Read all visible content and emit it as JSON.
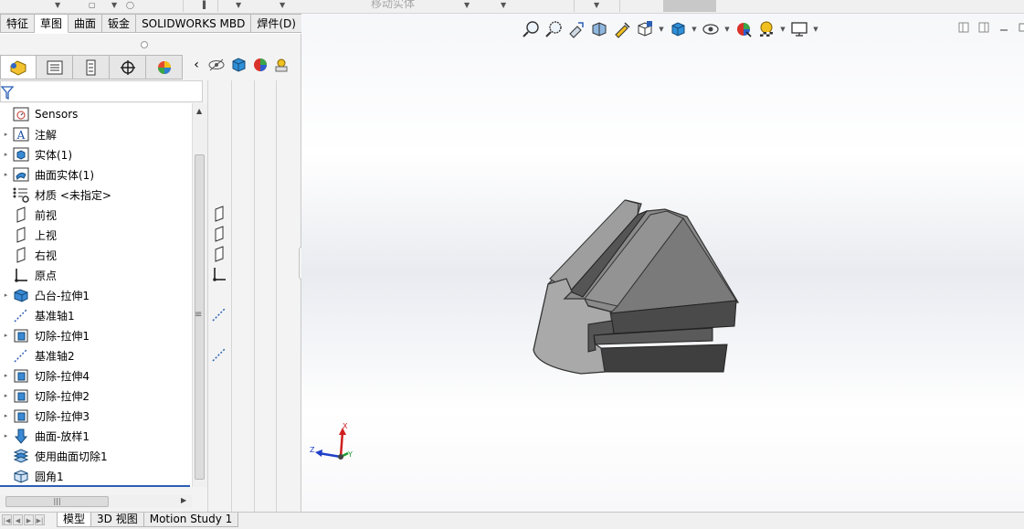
{
  "toolbar_top": {
    "faded_label": "移动实体"
  },
  "command_tabs": [
    {
      "label": "特征",
      "active": false
    },
    {
      "label": "草图",
      "active": true
    },
    {
      "label": "曲面",
      "active": false
    },
    {
      "label": "钣金",
      "active": false
    },
    {
      "label": "SOLIDWORKS MBD",
      "active": false
    },
    {
      "label": "焊件(D)",
      "active": false
    }
  ],
  "feature_tree": [
    {
      "label": "Sensors",
      "icon": "sensor-icon",
      "expandable": false
    },
    {
      "label": "注解",
      "icon": "annotation-icon",
      "expandable": true
    },
    {
      "label": "实体(1)",
      "icon": "solid-bodies-icon",
      "expandable": true
    },
    {
      "label": "曲面实体(1)",
      "icon": "surface-bodies-icon",
      "expandable": true
    },
    {
      "label": "材质 <未指定>",
      "icon": "material-icon",
      "expandable": false
    },
    {
      "label": "前视",
      "icon": "plane-icon",
      "expandable": false
    },
    {
      "label": "上视",
      "icon": "plane-icon",
      "expandable": false
    },
    {
      "label": "右视",
      "icon": "plane-icon",
      "expandable": false
    },
    {
      "label": "原点",
      "icon": "origin-icon",
      "expandable": false
    },
    {
      "label": "凸台-拉伸1",
      "icon": "extrude-boss-icon",
      "expandable": true
    },
    {
      "label": "基准轴1",
      "icon": "axis-icon",
      "expandable": false
    },
    {
      "label": "切除-拉伸1",
      "icon": "extrude-cut-icon",
      "expandable": true
    },
    {
      "label": "基准轴2",
      "icon": "axis-icon",
      "expandable": false
    },
    {
      "label": "切除-拉伸4",
      "icon": "extrude-cut-icon",
      "expandable": true
    },
    {
      "label": "切除-拉伸2",
      "icon": "extrude-cut-icon",
      "expandable": true
    },
    {
      "label": "切除-拉伸3",
      "icon": "extrude-cut-icon",
      "expandable": true
    },
    {
      "label": "曲面-放样1",
      "icon": "surface-loft-icon",
      "expandable": true
    },
    {
      "label": "使用曲面切除1",
      "icon": "surface-cut-icon",
      "expandable": false
    },
    {
      "label": "圆角1",
      "icon": "fillet-icon",
      "expandable": false
    }
  ],
  "triad": {
    "x": "X",
    "y": "Y",
    "z": "Z"
  },
  "bottom_tabs": [
    {
      "label": "模型",
      "active": true
    },
    {
      "label": "3D 视图",
      "active": false
    },
    {
      "label": "Motion Study 1",
      "active": false
    }
  ],
  "colors": {
    "accent": "#2b5fb5",
    "model_top": "#8a8a8a",
    "model_front": "#9c9c9c",
    "model_dark": "#4a4a4a"
  }
}
